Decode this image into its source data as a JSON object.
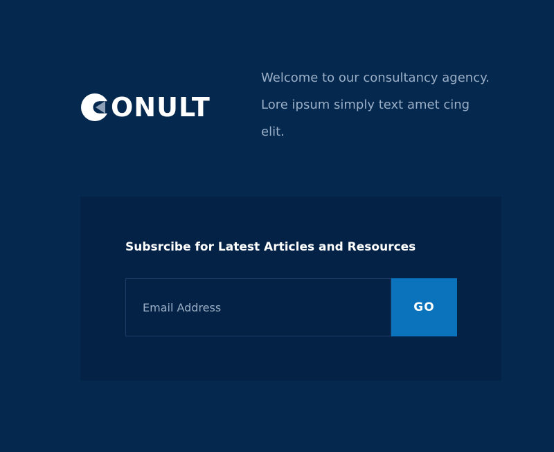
{
  "brand": {
    "logo_text": "ONULT",
    "logo_icon": "c-arrow-logo-mark",
    "logo_color": "#ffffff"
  },
  "intro": {
    "text": "Welcome to our consultancy agency. Lore ipsum simply text amet cing elit."
  },
  "subscribe": {
    "title": "Subsrcibe for Latest Articles and Resources",
    "email_placeholder": "Email Address",
    "email_value": "",
    "button_label": "GO"
  },
  "colors": {
    "background": "#05284f",
    "panel": "#042245",
    "text_muted": "#9bafc7",
    "accent": "#0a73bb"
  }
}
